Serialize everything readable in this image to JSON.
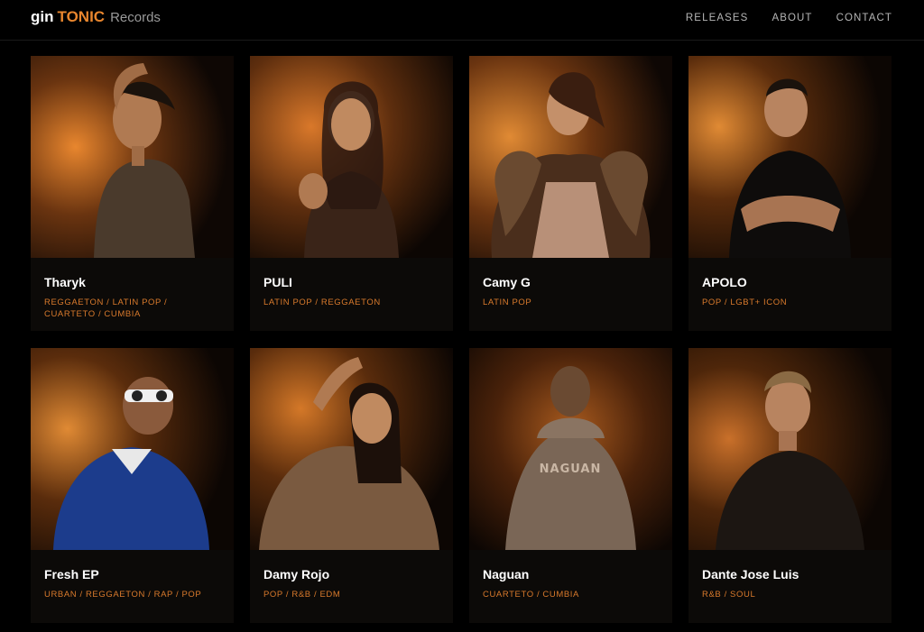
{
  "brand": {
    "part1": "gin",
    "part2": "TONIC",
    "part3": "Records"
  },
  "nav": {
    "items": [
      "RELEASES",
      "ABOUT",
      "CONTACT"
    ]
  },
  "colors": {
    "accent": "#e8862e",
    "background": "#000000",
    "card": "#0c0a08"
  },
  "artists": [
    {
      "name": "Tharyk",
      "genres": "REGGAETON / LATIN POP / CUARTETO / CUMBIA"
    },
    {
      "name": "PULI",
      "genres": "LATIN POP / REGGAETON"
    },
    {
      "name": "Camy G",
      "genres": "LATIN POP"
    },
    {
      "name": "APOLO",
      "genres": "POP / LGBT+ ICON"
    },
    {
      "name": "Fresh EP",
      "genres": "URBAN / REGGAETON / RAP / POP"
    },
    {
      "name": "Damy Rojo",
      "genres": "POP / R&B / EDM"
    },
    {
      "name": "Naguan",
      "genres": "CUARTETO / CUMBIA"
    },
    {
      "name": "Dante Jose Luis",
      "genres": "R&B / SOUL"
    }
  ]
}
